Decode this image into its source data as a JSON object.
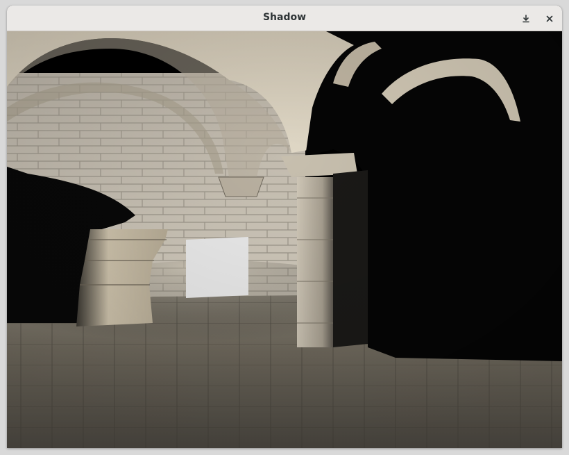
{
  "window": {
    "title": "Shadow",
    "controls": [
      {
        "name": "minimize",
        "icon": "download-arrow-icon"
      },
      {
        "name": "close",
        "icon": "close-icon"
      }
    ]
  },
  "scene": {
    "description_colors": {
      "stone_light": "#d8d0c0",
      "stone_mid": "#a89f8f",
      "floor": "#6f6a60",
      "shadow": "#050505",
      "cube": "#eaeaea"
    }
  }
}
